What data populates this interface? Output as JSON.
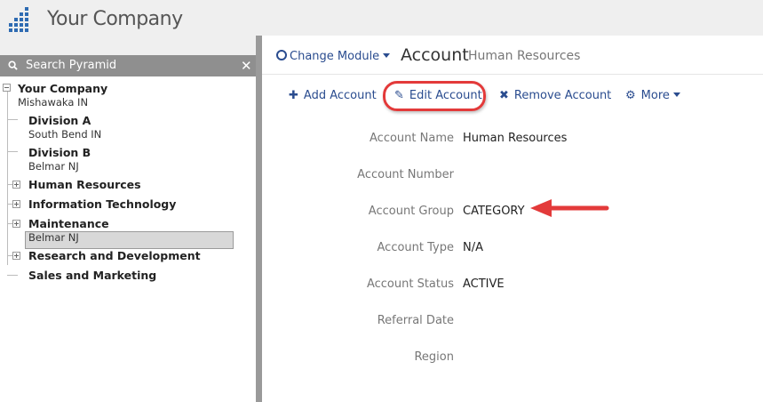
{
  "header": {
    "company_title": "Your Company"
  },
  "sidebar": {
    "search_label": "Search Pyramid",
    "tree": [
      {
        "name": "Your Company",
        "location": "Mishawaka IN"
      },
      {
        "name": "Division A",
        "location": "South Bend IN"
      },
      {
        "name": "Division B",
        "location": "Belmar NJ"
      },
      {
        "name": "Human Resources",
        "location": "",
        "selected": true
      },
      {
        "name": "Information Technology",
        "location": ""
      },
      {
        "name": "Maintenance",
        "location": "Belmar NJ"
      },
      {
        "name": "Research and Development",
        "location": ""
      },
      {
        "name": "Sales and Marketing",
        "location": ""
      }
    ]
  },
  "main": {
    "change_module": "Change Module",
    "title": "Account",
    "subtitle": "Human Resources",
    "toolbar": {
      "add": "Add Account",
      "edit": "Edit Account",
      "remove": "Remove Account",
      "more": "More"
    },
    "fields": [
      {
        "label": "Account Name",
        "value": "Human Resources"
      },
      {
        "label": "Account Number",
        "value": ""
      },
      {
        "label": "Account Group",
        "value": "CATEGORY"
      },
      {
        "label": "Account Type",
        "value": "N/A"
      },
      {
        "label": "Account Status",
        "value": "ACTIVE"
      },
      {
        "label": "Referral Date",
        "value": ""
      },
      {
        "label": "Region",
        "value": ""
      }
    ]
  },
  "colors": {
    "accent": "#2a4c8f",
    "highlight": "#e33a3a",
    "logo": "#2e6bb2"
  }
}
